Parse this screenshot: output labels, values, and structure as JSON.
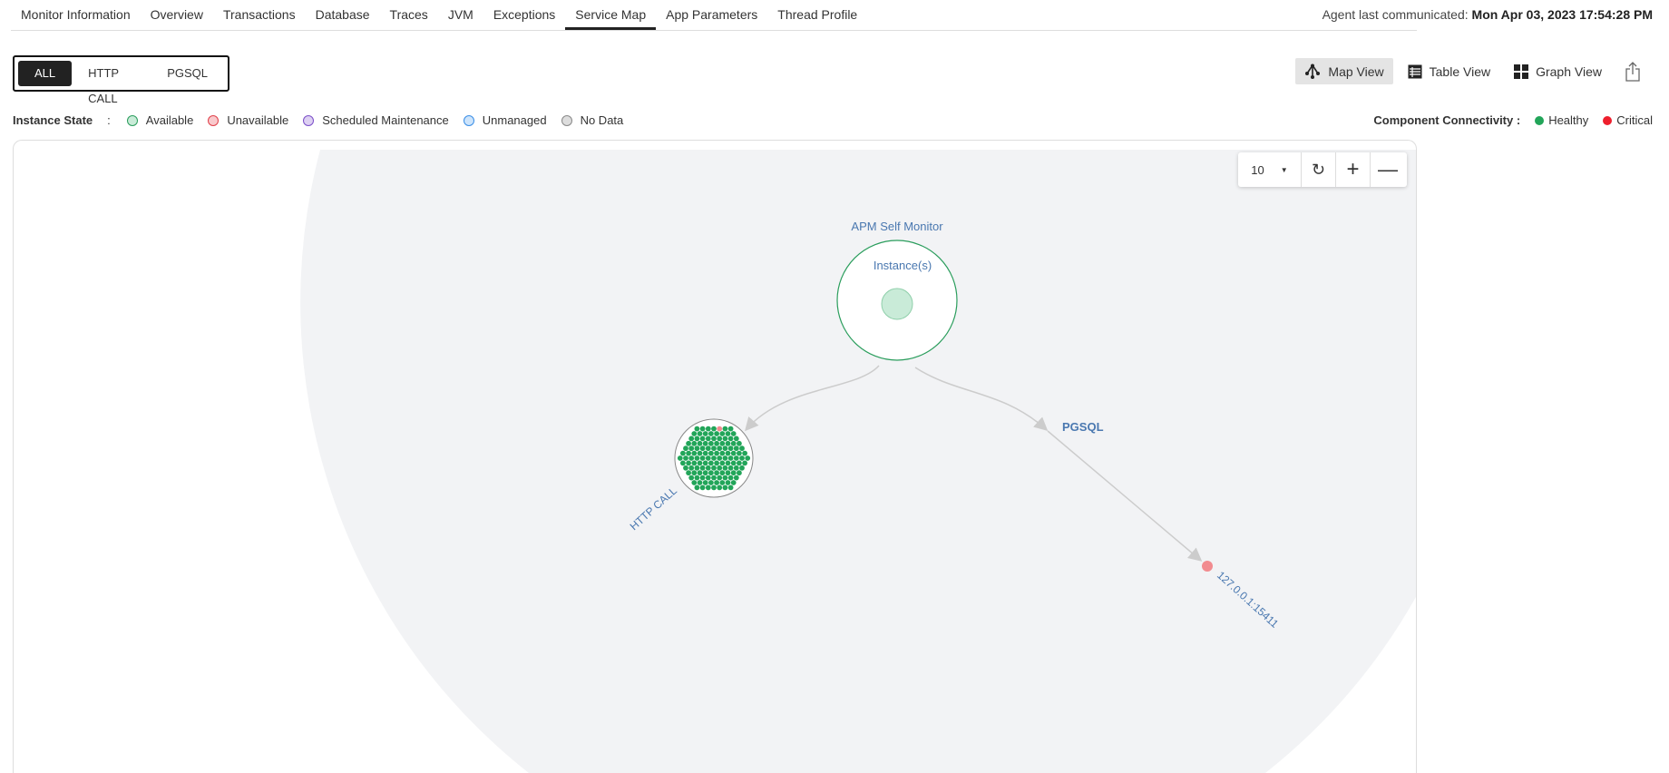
{
  "tabs": [
    "Monitor Information",
    "Overview",
    "Transactions",
    "Database",
    "Traces",
    "JVM",
    "Exceptions",
    "Service Map",
    "App Parameters",
    "Thread Profile"
  ],
  "agent": {
    "label": "Agent last communicated:",
    "value": "Mon Apr 03, 2023 17:54:28 PM"
  },
  "filters": [
    "ALL",
    "HTTP CALL",
    "PGSQL"
  ],
  "views": [
    "Map View",
    "Table View",
    "Graph View"
  ],
  "instance_state": {
    "label": "Instance State",
    "sep": ":",
    "items": [
      {
        "label": "Available",
        "fill": "#c9ebd8",
        "stroke": "#2a9d5c"
      },
      {
        "label": "Unavailable",
        "fill": "#f9c9cc",
        "stroke": "#e0404a"
      },
      {
        "label": "Scheduled Maintenance",
        "fill": "#ddd0f2",
        "stroke": "#7b4fc9"
      },
      {
        "label": "Unmanaged",
        "fill": "#cde4fb",
        "stroke": "#3a8ee6"
      },
      {
        "label": "No Data",
        "fill": "#ddd",
        "stroke": "#888"
      }
    ]
  },
  "connectivity": {
    "label": "Component Connectivity :",
    "items": [
      {
        "label": "Healthy",
        "color": "#22a559"
      },
      {
        "label": "Critical",
        "color": "#ee1f2d"
      }
    ]
  },
  "map": {
    "zoom": "10",
    "app_name": "APM Self Monitor",
    "instances_label": "Instance(s)",
    "http_label": "HTTP CALL",
    "pgsql_label": "PGSQL",
    "endpoint": "127.0.0.1:15411"
  }
}
